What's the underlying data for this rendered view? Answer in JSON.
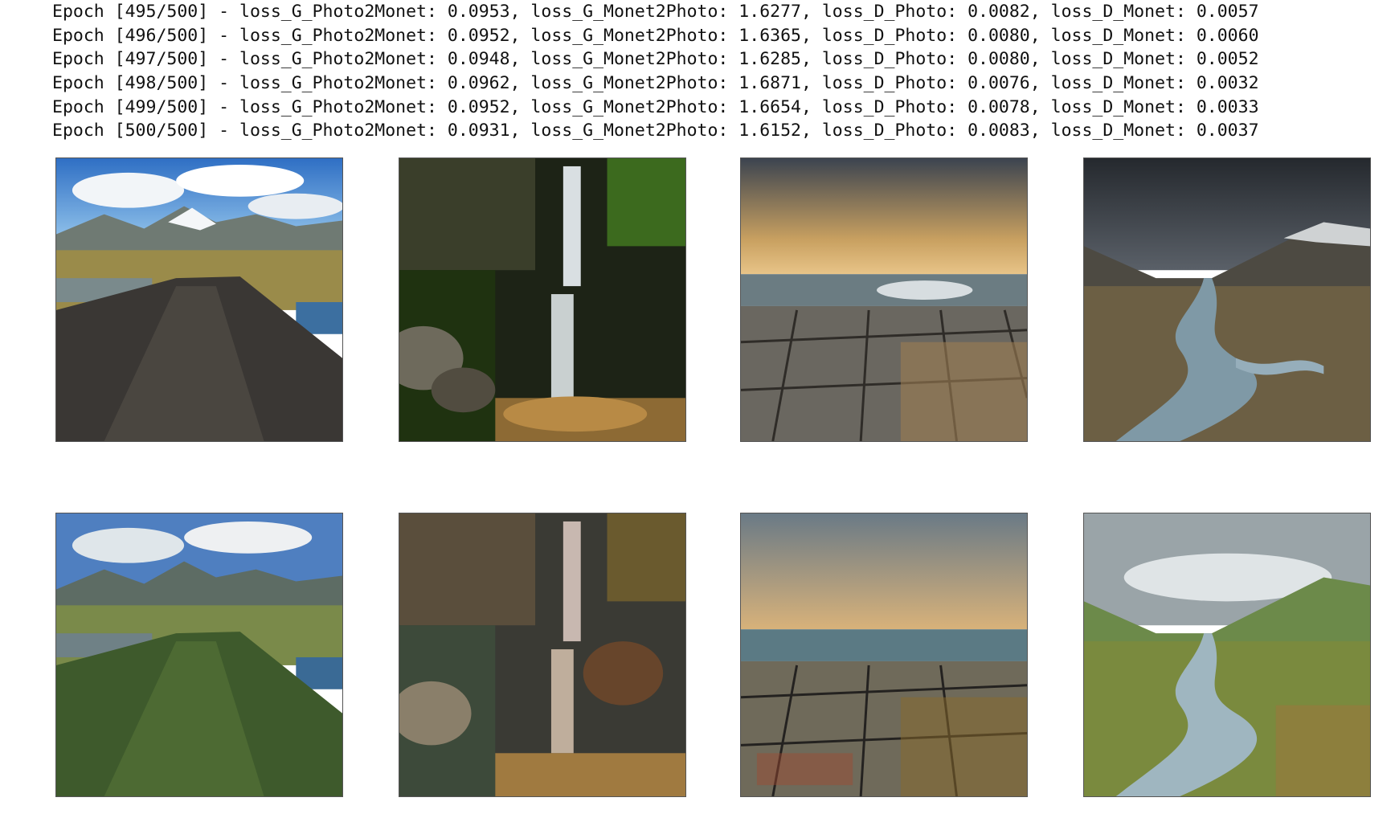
{
  "log": {
    "lines": [
      "Epoch [495/500] - loss_G_Photo2Monet: 0.0953, loss_G_Monet2Photo: 1.6277, loss_D_Photo: 0.0082, loss_D_Monet: 0.0057",
      "Epoch [496/500] - loss_G_Photo2Monet: 0.0952, loss_G_Monet2Photo: 1.6365, loss_D_Photo: 0.0080, loss_D_Monet: 0.0060",
      "Epoch [497/500] - loss_G_Photo2Monet: 0.0948, loss_G_Monet2Photo: 1.6285, loss_D_Photo: 0.0080, loss_D_Monet: 0.0052",
      "Epoch [498/500] - loss_G_Photo2Monet: 0.0962, loss_G_Monet2Photo: 1.6871, loss_D_Photo: 0.0076, loss_D_Monet: 0.0032",
      "Epoch [499/500] - loss_G_Photo2Monet: 0.0952, loss_G_Monet2Photo: 1.6654, loss_D_Photo: 0.0078, loss_D_Monet: 0.0033",
      "Epoch [500/500] - loss_G_Photo2Monet: 0.0931, loss_G_Monet2Photo: 1.6152, loss_D_Photo: 0.0083, loss_D_Monet: 0.0037"
    ]
  }
}
